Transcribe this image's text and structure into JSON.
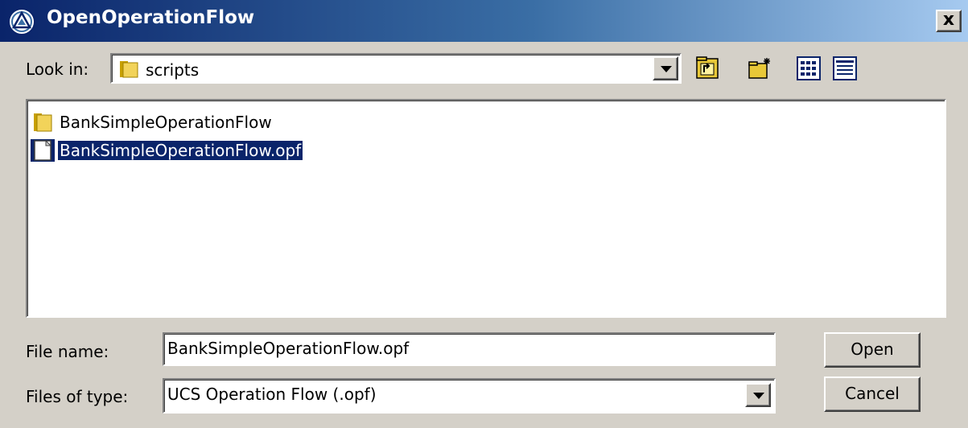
{
  "window": {
    "title": "OpenOperationFlow",
    "close_label": "x"
  },
  "lookin": {
    "label": "Look in:",
    "value": "scripts"
  },
  "toolbar": {
    "icons": [
      "up-one-level-icon",
      "create-new-folder-icon",
      "list-view-icon",
      "details-view-icon"
    ]
  },
  "files": [
    {
      "name": "BankSimpleOperationFlow",
      "type": "folder",
      "selected": false
    },
    {
      "name": "BankSimpleOperationFlow.opf",
      "type": "file",
      "selected": true
    }
  ],
  "filename": {
    "label": "File name:",
    "value": "BankSimpleOperationFlow.opf"
  },
  "filetype": {
    "label": "Files of type:",
    "value": "UCS Operation Flow (.opf)"
  },
  "buttons": {
    "open": "Open",
    "cancel": "Cancel"
  },
  "colors": {
    "titlebar_start": "#0a246a",
    "titlebar_end": "#a6caf0",
    "selection": "#0a246a",
    "dialog_bg": "#d4d0c8"
  }
}
